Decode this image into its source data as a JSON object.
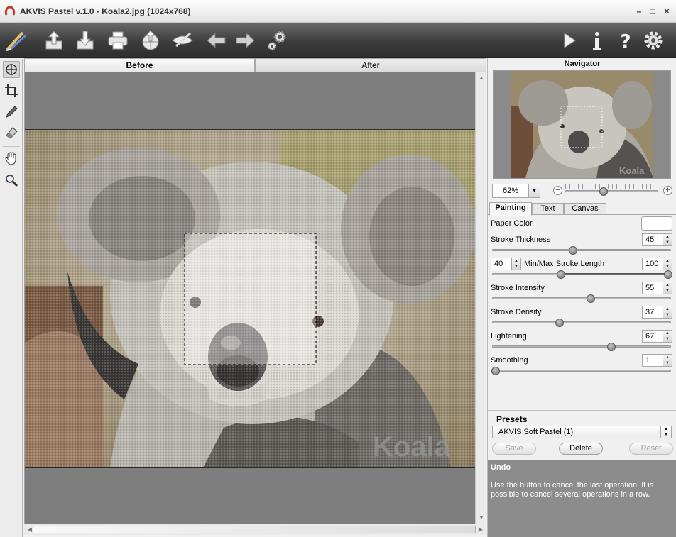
{
  "window": {
    "title": "AKVIS Pastel v.1.0 - Koala2.jpg (1024x768)"
  },
  "toolbar": {
    "left_icons": [
      "pastel-logo-icon",
      "open-file-icon",
      "save-file-icon",
      "print-icon",
      "share-icon",
      "eye-preview-icon",
      "undo-arrow-icon",
      "redo-arrow-icon",
      "preferences-gears-icon"
    ],
    "right_icons": [
      "run-icon",
      "info-icon",
      "help-icon",
      "settings-gear-icon"
    ]
  },
  "tools": [
    "move-view-icon",
    "crop-icon",
    "pencil-icon",
    "eraser-icon",
    "hand-icon",
    "zoom-magnifier-icon"
  ],
  "view_tabs": {
    "before": "Before",
    "after": "After"
  },
  "watermark": "Koala",
  "navigator": {
    "title": "Navigator",
    "zoom": "62%",
    "zoom_level_fraction": 0.43
  },
  "settings_tabs": {
    "painting": "Painting",
    "text": "Text",
    "canvas": "Canvas"
  },
  "params": {
    "paper_color": {
      "label": "Paper Color",
      "color": "#ffffff"
    },
    "stroke_thickness": {
      "label": "Stroke Thickness",
      "value": "45"
    },
    "stroke_length": {
      "label": "Min/Max Stroke Length",
      "min": "40",
      "max": "100"
    },
    "stroke_intensity": {
      "label": "Stroke Intensity",
      "value": "55"
    },
    "stroke_density": {
      "label": "Stroke Density",
      "value": "37"
    },
    "lightening": {
      "label": "Lightening",
      "value": "67"
    },
    "smoothing": {
      "label": "Smoothing",
      "value": "1"
    }
  },
  "presets": {
    "title": "Presets",
    "selected": "AKVIS Soft Pastel (1)",
    "save": "Save",
    "delete": "Delete",
    "reset": "Reset"
  },
  "help": {
    "title": "Undo",
    "text": "Use the button to cancel the last operation. It is possible to cancel several operations in a row."
  }
}
